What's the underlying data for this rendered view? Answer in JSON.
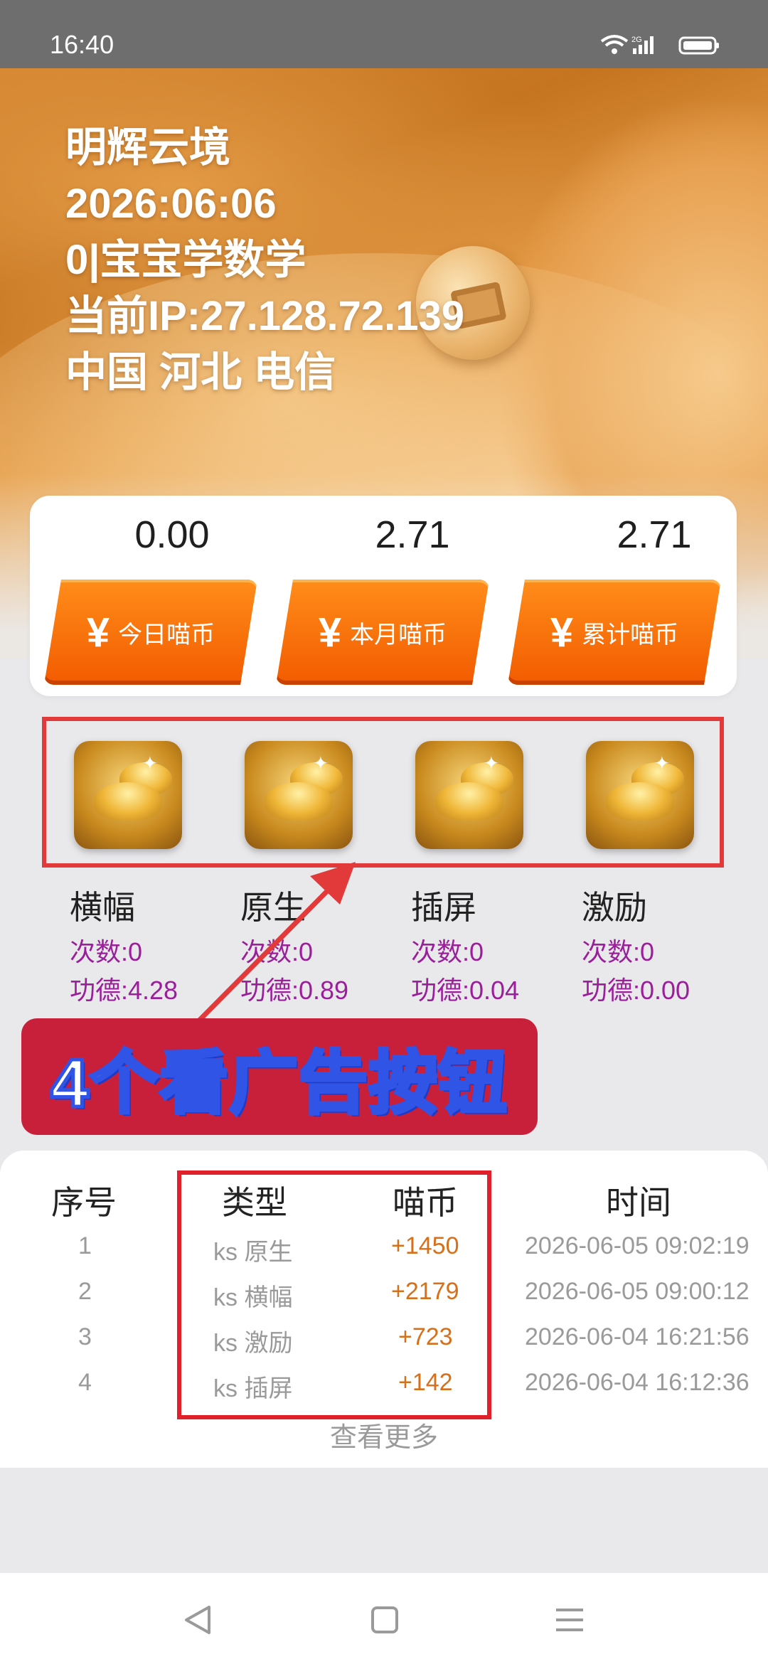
{
  "status_bar": {
    "time": "16:40",
    "network": "2G"
  },
  "hero": {
    "lines": [
      "明辉云境",
      "2026:06:06",
      "0|宝宝学数学",
      "当前IP:27.128.72.139",
      "中国 河北   电信"
    ]
  },
  "stats": [
    {
      "value": "0.00",
      "label": "今日喵币"
    },
    {
      "value": "2.71",
      "label": "本月喵币"
    },
    {
      "value": "2.71",
      "label": "累计喵币"
    }
  ],
  "yen_symbol": "¥",
  "ad_buttons": [
    {
      "label": "横幅",
      "count": "次数:0",
      "merit": "功德:4.28"
    },
    {
      "label": "原生",
      "count": "次数:0",
      "merit": "功德:0.89"
    },
    {
      "label": "插屏",
      "count": "次数:0",
      "merit": "功德:0.04"
    },
    {
      "label": "激励",
      "count": "次数:0",
      "merit": "功德:0.00"
    }
  ],
  "annotation": {
    "banner_text": "4个看广告按钮",
    "frame_color": "#e23a3a",
    "banner_color": "#c81f3b"
  },
  "table": {
    "headers": [
      "序号",
      "类型",
      "喵币",
      "时间"
    ],
    "rows": [
      [
        "1",
        "ks 原生",
        "+1450",
        "2026-06-05 09:02:19"
      ],
      [
        "2",
        "ks 横幅",
        "+2179",
        "2026-06-05 09:00:12"
      ],
      [
        "3",
        "ks 激励",
        "+723",
        "2026-06-04 16:21:56"
      ],
      [
        "4",
        "ks 插屏",
        "+142",
        "2026-06-04 16:12:36"
      ]
    ],
    "more_label": "查看更多"
  },
  "nav": {
    "icons": [
      "back-icon",
      "home-icon",
      "menu-icon"
    ]
  },
  "colors": {
    "accent_orange": "#f25b00",
    "coin_text": "#d6701b",
    "merit_purple": "#9b1f9b"
  }
}
